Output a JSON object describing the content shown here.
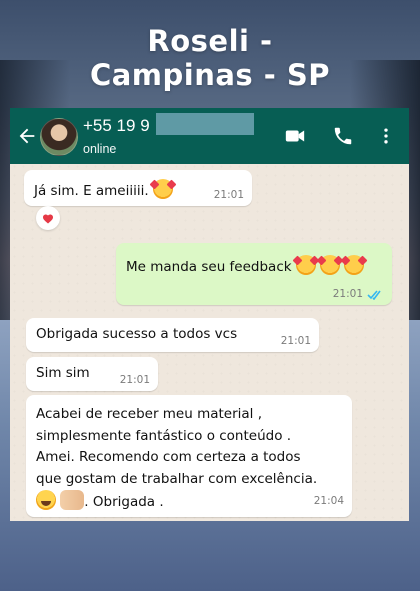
{
  "headline": {
    "line1": "Roseli -",
    "line2": "Campinas - SP"
  },
  "header": {
    "number_visible": "+55 19 9",
    "status": "online"
  },
  "icons": {
    "back": "arrow-left-icon",
    "video": "video-call-icon",
    "call": "phone-icon",
    "menu": "more-vert-icon",
    "reaction": "red-heart-icon",
    "ticks": "double-check-icon"
  },
  "colors": {
    "header": "#075e54",
    "incoming": "#ffffff",
    "outgoing": "#dcf8c6",
    "read_tick": "#34b7f1"
  },
  "messages": [
    {
      "direction": "in",
      "text": "Já sim.  E ameiiiii.",
      "emoji": "smiling-face-with-hearts",
      "time": "21:01",
      "reaction": "heart"
    },
    {
      "direction": "out",
      "text": "Me manda seu feedback",
      "emoji": "smiling-face-with-hearts x3",
      "time": "21:01",
      "read": true
    },
    {
      "direction": "in",
      "text": "Obrigada  sucesso a todos vcs",
      "time": "21:01"
    },
    {
      "direction": "in",
      "text": "Sim sim",
      "time": "21:01"
    },
    {
      "direction": "in",
      "lines": [
        "Acabei de receber meu material ,",
        "simplesmente fantástico o conteúdo .",
        "Amei. Recomendo com certeza a todos",
        "que gostam de trabalhar com excelência."
      ],
      "tail": ". Obrigada .",
      "emoji": "grinning-face, raising-hands",
      "time": "21:04"
    }
  ]
}
